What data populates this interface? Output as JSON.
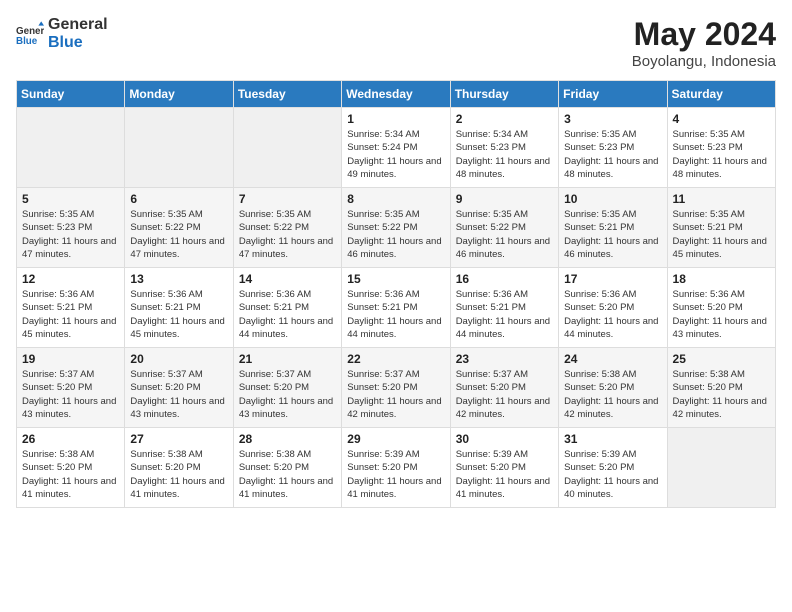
{
  "header": {
    "logo_general": "General",
    "logo_blue": "Blue",
    "month_year": "May 2024",
    "location": "Boyolangu, Indonesia"
  },
  "days_of_week": [
    "Sunday",
    "Monday",
    "Tuesday",
    "Wednesday",
    "Thursday",
    "Friday",
    "Saturday"
  ],
  "weeks": [
    [
      {
        "day": "",
        "empty": true
      },
      {
        "day": "",
        "empty": true
      },
      {
        "day": "",
        "empty": true
      },
      {
        "day": "1",
        "sunrise": "5:34 AM",
        "sunset": "5:24 PM",
        "daylight": "11 hours and 49 minutes."
      },
      {
        "day": "2",
        "sunrise": "5:34 AM",
        "sunset": "5:23 PM",
        "daylight": "11 hours and 48 minutes."
      },
      {
        "day": "3",
        "sunrise": "5:35 AM",
        "sunset": "5:23 PM",
        "daylight": "11 hours and 48 minutes."
      },
      {
        "day": "4",
        "sunrise": "5:35 AM",
        "sunset": "5:23 PM",
        "daylight": "11 hours and 48 minutes."
      }
    ],
    [
      {
        "day": "5",
        "sunrise": "5:35 AM",
        "sunset": "5:23 PM",
        "daylight": "11 hours and 47 minutes."
      },
      {
        "day": "6",
        "sunrise": "5:35 AM",
        "sunset": "5:22 PM",
        "daylight": "11 hours and 47 minutes."
      },
      {
        "day": "7",
        "sunrise": "5:35 AM",
        "sunset": "5:22 PM",
        "daylight": "11 hours and 47 minutes."
      },
      {
        "day": "8",
        "sunrise": "5:35 AM",
        "sunset": "5:22 PM",
        "daylight": "11 hours and 46 minutes."
      },
      {
        "day": "9",
        "sunrise": "5:35 AM",
        "sunset": "5:22 PM",
        "daylight": "11 hours and 46 minutes."
      },
      {
        "day": "10",
        "sunrise": "5:35 AM",
        "sunset": "5:21 PM",
        "daylight": "11 hours and 46 minutes."
      },
      {
        "day": "11",
        "sunrise": "5:35 AM",
        "sunset": "5:21 PM",
        "daylight": "11 hours and 45 minutes."
      }
    ],
    [
      {
        "day": "12",
        "sunrise": "5:36 AM",
        "sunset": "5:21 PM",
        "daylight": "11 hours and 45 minutes."
      },
      {
        "day": "13",
        "sunrise": "5:36 AM",
        "sunset": "5:21 PM",
        "daylight": "11 hours and 45 minutes."
      },
      {
        "day": "14",
        "sunrise": "5:36 AM",
        "sunset": "5:21 PM",
        "daylight": "11 hours and 44 minutes."
      },
      {
        "day": "15",
        "sunrise": "5:36 AM",
        "sunset": "5:21 PM",
        "daylight": "11 hours and 44 minutes."
      },
      {
        "day": "16",
        "sunrise": "5:36 AM",
        "sunset": "5:21 PM",
        "daylight": "11 hours and 44 minutes."
      },
      {
        "day": "17",
        "sunrise": "5:36 AM",
        "sunset": "5:20 PM",
        "daylight": "11 hours and 44 minutes."
      },
      {
        "day": "18",
        "sunrise": "5:36 AM",
        "sunset": "5:20 PM",
        "daylight": "11 hours and 43 minutes."
      }
    ],
    [
      {
        "day": "19",
        "sunrise": "5:37 AM",
        "sunset": "5:20 PM",
        "daylight": "11 hours and 43 minutes."
      },
      {
        "day": "20",
        "sunrise": "5:37 AM",
        "sunset": "5:20 PM",
        "daylight": "11 hours and 43 minutes."
      },
      {
        "day": "21",
        "sunrise": "5:37 AM",
        "sunset": "5:20 PM",
        "daylight": "11 hours and 43 minutes."
      },
      {
        "day": "22",
        "sunrise": "5:37 AM",
        "sunset": "5:20 PM",
        "daylight": "11 hours and 42 minutes."
      },
      {
        "day": "23",
        "sunrise": "5:37 AM",
        "sunset": "5:20 PM",
        "daylight": "11 hours and 42 minutes."
      },
      {
        "day": "24",
        "sunrise": "5:38 AM",
        "sunset": "5:20 PM",
        "daylight": "11 hours and 42 minutes."
      },
      {
        "day": "25",
        "sunrise": "5:38 AM",
        "sunset": "5:20 PM",
        "daylight": "11 hours and 42 minutes."
      }
    ],
    [
      {
        "day": "26",
        "sunrise": "5:38 AM",
        "sunset": "5:20 PM",
        "daylight": "11 hours and 41 minutes."
      },
      {
        "day": "27",
        "sunrise": "5:38 AM",
        "sunset": "5:20 PM",
        "daylight": "11 hours and 41 minutes."
      },
      {
        "day": "28",
        "sunrise": "5:38 AM",
        "sunset": "5:20 PM",
        "daylight": "11 hours and 41 minutes."
      },
      {
        "day": "29",
        "sunrise": "5:39 AM",
        "sunset": "5:20 PM",
        "daylight": "11 hours and 41 minutes."
      },
      {
        "day": "30",
        "sunrise": "5:39 AM",
        "sunset": "5:20 PM",
        "daylight": "11 hours and 41 minutes."
      },
      {
        "day": "31",
        "sunrise": "5:39 AM",
        "sunset": "5:20 PM",
        "daylight": "11 hours and 40 minutes."
      },
      {
        "day": "",
        "empty": true
      }
    ]
  ]
}
